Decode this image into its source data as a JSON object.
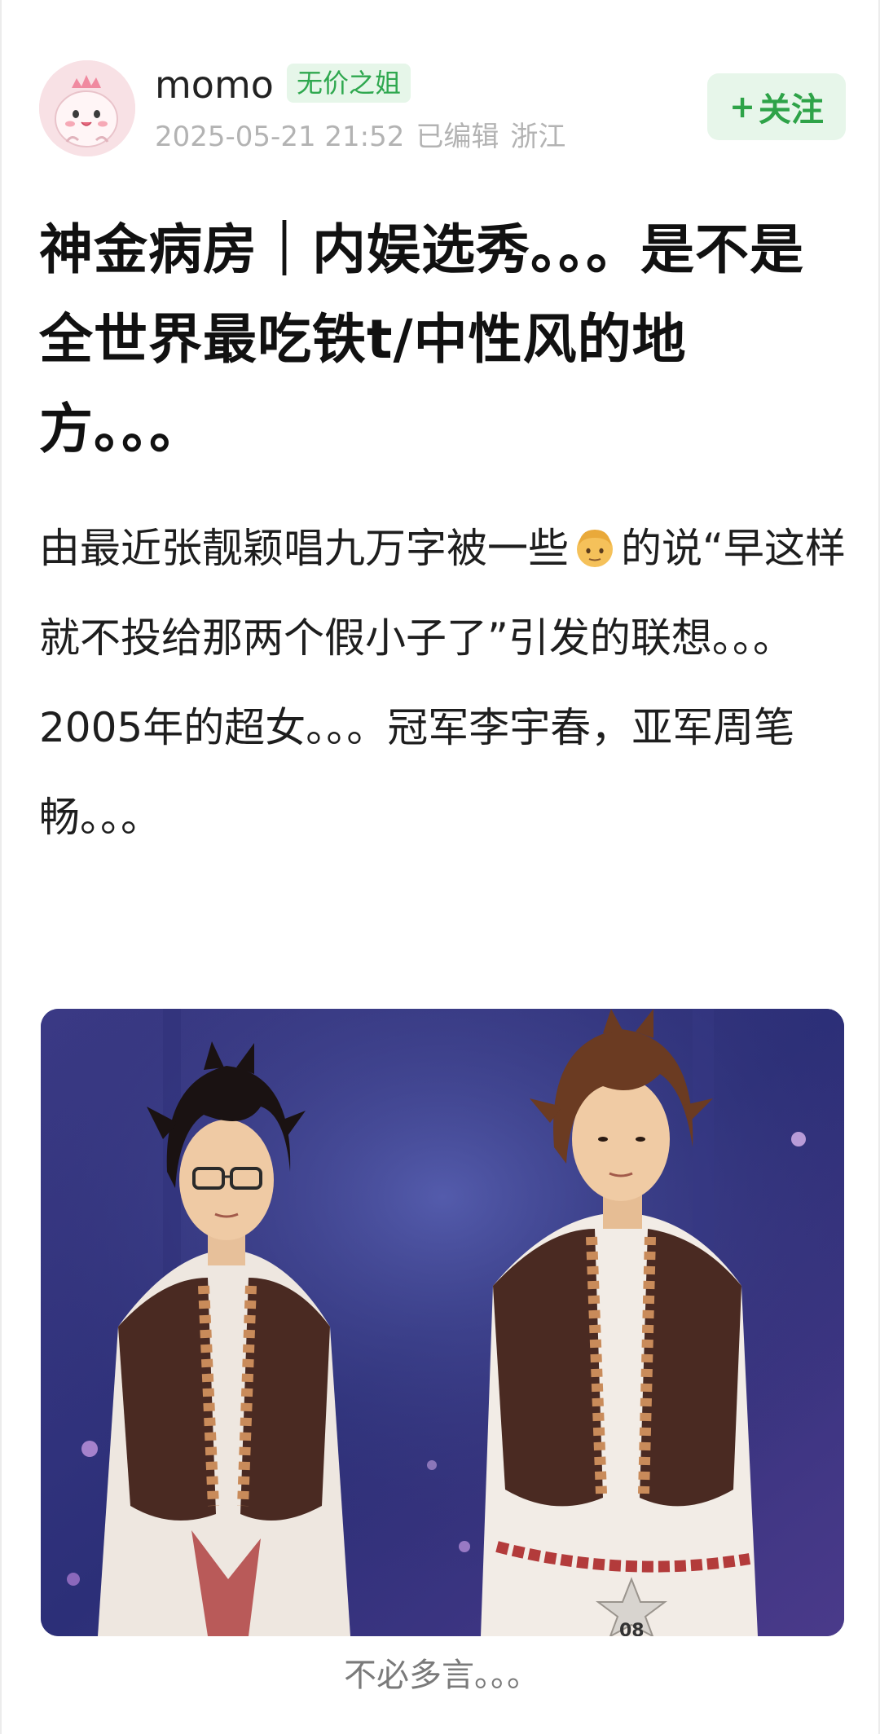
{
  "header": {
    "username": "momo",
    "badge": "无价之姐",
    "date": "2025-05-21 21:52",
    "edited": "已编辑",
    "location": "浙江",
    "follow_label": "关注",
    "follow_plus": "+"
  },
  "post": {
    "title": "神金病房｜内娱选秀。。。是不是全世界最吃铁t/中性风的地方。。。",
    "body_1a": "由最近张靓颖唱九万字被一些",
    "body_1b": "的说“早这样就不投给那两个假小子了”引发的联想。。。",
    "body_2": "2005年的超女。。。冠军李宇春，亚军周笔畅。。。",
    "emoji_icon": "man-face-emoji-icon"
  },
  "image": {
    "caption": "不必多言。。。",
    "contestant_number": "08"
  },
  "colors": {
    "accent_green": "#2ea348",
    "badge_bg": "#e6f6e9",
    "meta_gray": "#b3b3b3",
    "avatar_bg": "#f7dde2"
  }
}
